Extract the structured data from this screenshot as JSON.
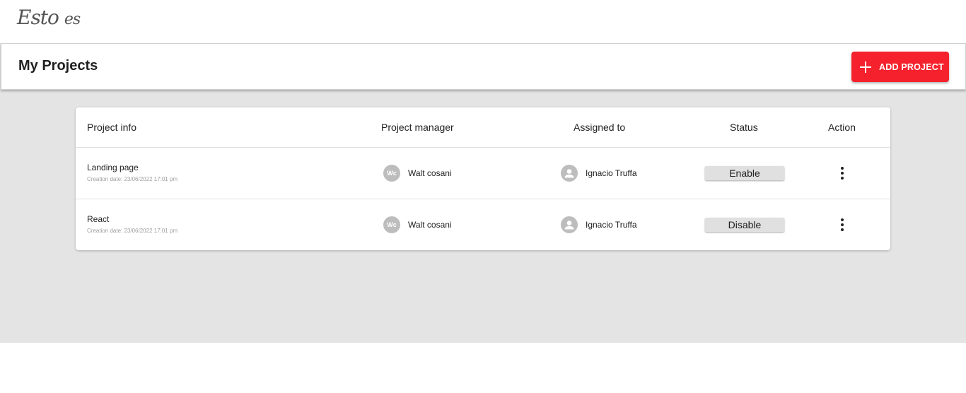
{
  "app": {
    "logo_main": "Esto",
    "logo_suffix": "es"
  },
  "header": {
    "title": "My Projects",
    "add_button_label": "ADD PROJECT",
    "add_button_icon": "plus-icon",
    "accent_color": "#f5222d"
  },
  "table": {
    "columns": [
      "Project info",
      "Project manager",
      "Assigned to",
      "Status",
      "Action"
    ],
    "rows": [
      {
        "name": "Landing page",
        "creation_date": "Creation date: 23/06/2022 17:01 pm",
        "manager_initials": "Wc",
        "manager_name": "Walt cosani",
        "assignee_icon": "person-icon",
        "assignee_name": "Ignacio Truffa",
        "status_label": "Enable",
        "action_icon": "more-vert-icon"
      },
      {
        "name": "React",
        "creation_date": "Creation date: 23/06/2022 17:01 pm",
        "manager_initials": "Wc",
        "manager_name": "Walt cosani",
        "assignee_icon": "person-icon",
        "assignee_name": "Ignacio Truffa",
        "status_label": "Disable",
        "action_icon": "more-vert-icon"
      }
    ]
  }
}
